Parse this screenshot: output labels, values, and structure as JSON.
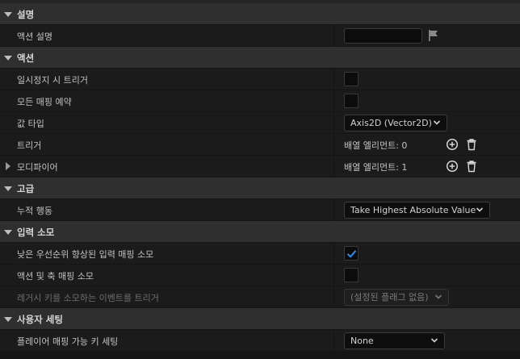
{
  "sections": {
    "description": {
      "title": "설명"
    },
    "action": {
      "title": "액션"
    },
    "advanced": {
      "title": "고급"
    },
    "input_consumption": {
      "title": "입력 소모"
    },
    "user_settings": {
      "title": "사용자 세팅"
    }
  },
  "properties": {
    "action_description": {
      "label": "액션 설명",
      "value": ""
    },
    "trigger_when_paused": {
      "label": "일시정지 시 트리거",
      "checked": false
    },
    "reserve_all_mappings": {
      "label": "모든 매핑 예약",
      "checked": false
    },
    "value_type": {
      "label": "값 타입",
      "selected": "Axis2D (Vector2D)"
    },
    "triggers": {
      "label": "트리거",
      "array_text": "배열 엘리먼트: 0"
    },
    "modifiers": {
      "label": "모디파이어",
      "array_text": "배열 엘리먼트: 1"
    },
    "accumulation_behavior": {
      "label": "누적 행동",
      "selected": "Take Highest Absolute Value"
    },
    "consume_lower_priority": {
      "label": "낮은 우선순위 향상된 입력 매핑 소모",
      "checked": true
    },
    "consume_action_axis": {
      "label": "액션 및 축 매핑 소모",
      "checked": false
    },
    "legacy_trigger_events": {
      "label": "레거시 키를 소모하는 이벤트를 트리거",
      "selected": "(설정된 플래그 없음)"
    },
    "player_mappable_key_settings": {
      "label": "플레이어 매핑 가능 키 세팅",
      "selected": "None"
    }
  },
  "icons": {
    "flag": "flag-icon",
    "add": "add-element-icon",
    "delete": "delete-icon",
    "check": "checkmark-icon"
  },
  "colors": {
    "accent_check": "#2a8cf0",
    "section_bg": "#2f2f2f",
    "row_bg": "#1b1b1b"
  }
}
